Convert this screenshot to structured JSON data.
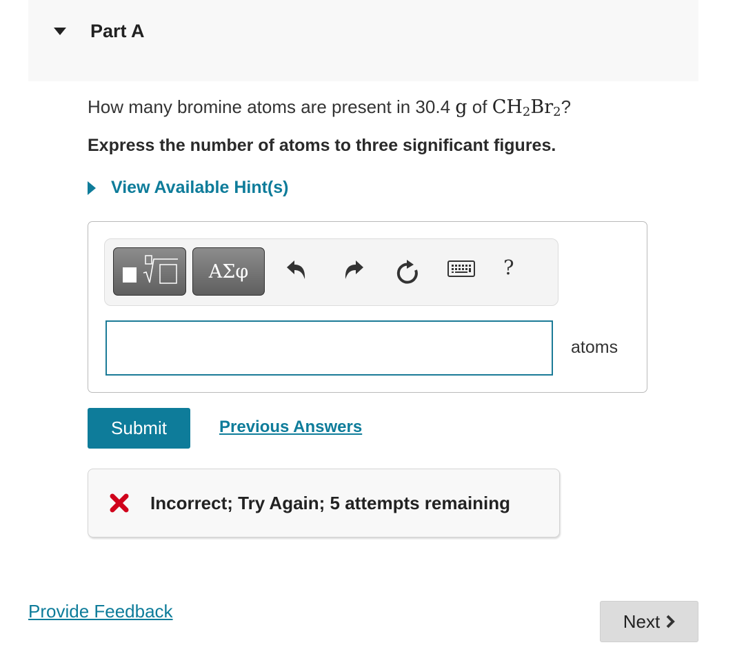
{
  "part": {
    "title": "Part A",
    "expanded": true,
    "toggle_icon": "caret-down-icon"
  },
  "question": {
    "prefix": "How many bromine atoms are present in 30.4 ",
    "unit": "g",
    "middle": " of ",
    "formula_parts": [
      "CH",
      "2",
      "Br",
      "2"
    ],
    "suffix": "?",
    "instruction": "Express the number of atoms to three significant figures."
  },
  "hint": {
    "label": "View Available Hint(s)",
    "icon": "caret-right-icon"
  },
  "toolbar": {
    "templates_icon": "templates-radical-icon",
    "greek_label": "ΑΣφ",
    "undo_icon": "undo-icon",
    "redo_icon": "redo-icon",
    "reset_icon": "reset-icon",
    "keyboard_icon": "keyboard-icon",
    "help_label": "?"
  },
  "answer": {
    "value": "",
    "placeholder": "",
    "units": "atoms"
  },
  "actions": {
    "submit_label": "Submit",
    "previous_answers_label": "Previous Answers"
  },
  "feedback": {
    "status": "incorrect",
    "icon": "x-icon",
    "message": "Incorrect; Try Again; 5 attempts remaining",
    "attempts_remaining": 5,
    "icon_color": "#d0021b"
  },
  "footer": {
    "provide_feedback_label": "Provide Feedback",
    "next_label": "Next"
  },
  "colors": {
    "accent": "#0e7c9a",
    "header_bg": "#f8f8f8",
    "error": "#d0021b"
  }
}
